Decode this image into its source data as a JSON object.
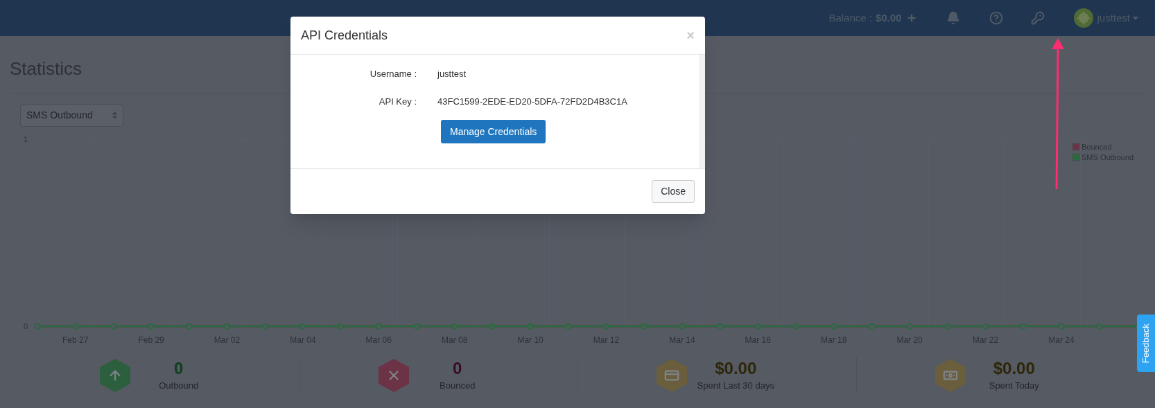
{
  "header": {
    "balance_label": "Balance :",
    "balance_value": "$0.00",
    "username": "justtest"
  },
  "page": {
    "title": "Statistics",
    "metric_select": {
      "value": "SMS Outbound"
    }
  },
  "chart": {
    "chart_data": {
      "type": "line",
      "categories": [
        null,
        "Feb 27",
        null,
        "Feb 29",
        null,
        "Mar 02",
        null,
        "Mar 04",
        null,
        "Mar 06",
        null,
        "Mar 08",
        null,
        "Mar 10",
        null,
        "Mar 12",
        null,
        "Mar 14",
        null,
        "Mar 16",
        null,
        "Mar 18",
        null,
        "Mar 20",
        null,
        "Mar 22",
        null,
        "Mar 24",
        null,
        null
      ],
      "ylim": [
        0,
        1
      ],
      "yticks": [
        0,
        1
      ],
      "legend": "upper right",
      "series": [
        {
          "name": "Bounced",
          "color": "#6b3345",
          "values": [
            0,
            0,
            0,
            0,
            0,
            0,
            0,
            0,
            0,
            0,
            0,
            0,
            0,
            0,
            0,
            0,
            0,
            0,
            0,
            0,
            0,
            0,
            0,
            0,
            0,
            0,
            0,
            0,
            0,
            0
          ]
        },
        {
          "name": "SMS Outbound",
          "color": "#2a6b3e",
          "marker": "circle",
          "values": [
            0,
            0,
            0,
            0,
            0,
            0,
            0,
            0,
            0,
            0,
            0,
            0,
            0,
            0,
            0,
            0,
            0,
            0,
            0,
            0,
            0,
            0,
            0,
            0,
            0,
            0,
            0,
            0,
            0,
            0
          ]
        }
      ]
    }
  },
  "stats": [
    {
      "kind": "outbound",
      "value": "0",
      "label": "Outbound",
      "color": "#2b5f3d"
    },
    {
      "kind": "bounced",
      "value": "0",
      "label": "Bounced",
      "color": "#6b3345"
    },
    {
      "kind": "spent_30_days",
      "value": "$0.00",
      "label": "Spent Last 30 days",
      "color": "#6b5e3c"
    },
    {
      "kind": "spent_today",
      "value": "$0.00",
      "label": "Spent Today",
      "color": "#6b5e3c"
    }
  ],
  "feedback_tab": "Feedback",
  "modal": {
    "title": "API Credentials",
    "close_glyph": "×",
    "fields": [
      {
        "label": "Username :",
        "value": "justtest"
      },
      {
        "label": "API Key :",
        "value": "43FC1599-2EDE-ED20-5DFA-72FD2D4B3C1A"
      }
    ],
    "primary_button": "Manage Credentials",
    "close_button": "Close"
  }
}
